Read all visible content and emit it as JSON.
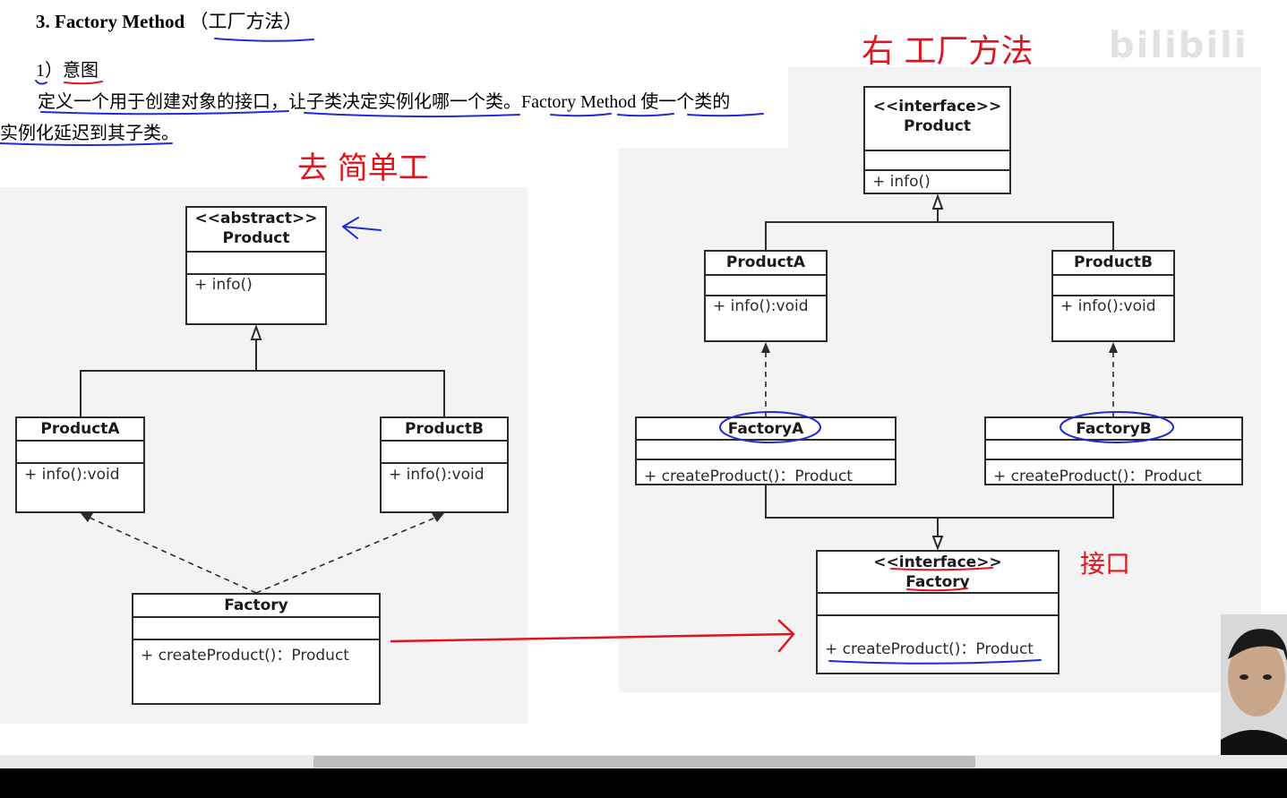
{
  "document": {
    "heading_number": "3.",
    "heading_title": "Factory Method",
    "heading_cn": "（工厂方法）",
    "subheading": "1）意图",
    "paragraph_line1": "定义一个用于创建对象的接口，让子类决定实例化哪一个类。Factory Method 使一个类的",
    "paragraph_line2": "实例化延迟到其子类。"
  },
  "left_diagram": {
    "product": {
      "stereotype": "<<abstract>>",
      "name": "Product",
      "method": "+ info()"
    },
    "product_a": {
      "name": "ProductA",
      "method": "+ info():void"
    },
    "product_b": {
      "name": "ProductB",
      "method": "+ info():void"
    },
    "factory": {
      "name": "Factory",
      "method": "+ createProduct()：Product"
    }
  },
  "right_diagram": {
    "product": {
      "stereotype": "<<interface>>",
      "name": "Product",
      "method": "+ info()"
    },
    "product_a": {
      "name": "ProductA",
      "method": "+ info():void"
    },
    "product_b": {
      "name": "ProductB",
      "method": "+ info():void"
    },
    "factory_a": {
      "name": "FactoryA",
      "method": "+ createProduct()：Product"
    },
    "factory_b": {
      "name": "FactoryB",
      "method": "+ createProduct()：Product"
    },
    "factory": {
      "stereotype": "<<interface>>",
      "name": "Factory",
      "method": "+ createProduct()：Product"
    }
  },
  "handwriting": {
    "left_note": "去 简单工",
    "right_note": "右 工厂方法",
    "interface_note": "接口"
  },
  "watermark": "bilibili",
  "colors": {
    "ink_blue": "#1f2bd6",
    "ink_red": "#e0141c",
    "panel": "#f3f3f3",
    "uml_border": "#2b2b2b"
  }
}
